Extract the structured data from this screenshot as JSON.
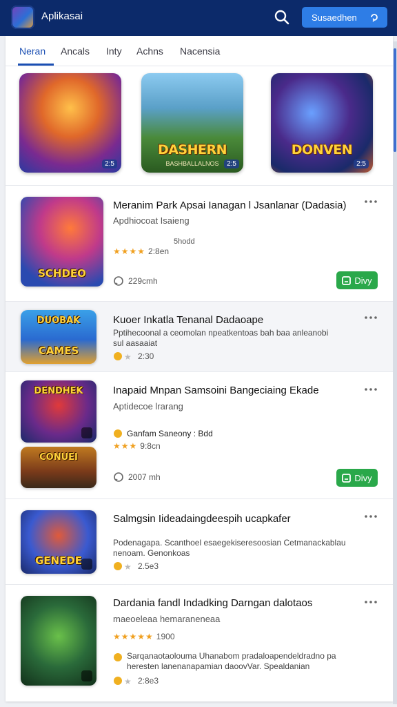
{
  "header": {
    "app_title": "Aplikasai",
    "action_label": "Susaedhen"
  },
  "tabs": [
    {
      "label": "Neran",
      "active": true
    },
    {
      "label": "Ancals",
      "active": false
    },
    {
      "label": "Inty",
      "active": false
    },
    {
      "label": "Achns",
      "active": false
    },
    {
      "label": "Nacensia",
      "active": false
    }
  ],
  "featured": [
    {
      "title": "",
      "sub": "",
      "badge": "2:5",
      "colors": [
        "#f08a24",
        "#7a2a90",
        "#2a3aa0"
      ]
    },
    {
      "title": "DASHERN",
      "sub": "BASHBALLALNOS",
      "badge": "2:5",
      "colors": [
        "#7fc0e8",
        "#4a8a3a",
        "#2a5a20"
      ]
    },
    {
      "title": "DONVEN",
      "sub": "",
      "badge": "2:5",
      "colors": [
        "#1a2a6a",
        "#4a2a8a",
        "#c05a30"
      ]
    }
  ],
  "apps": [
    {
      "title": "Meranim Park Apsai  Ianagan l Jsanlanar (Dadasia)",
      "subtitle": "Apdhiocoat Isaieng",
      "note": "5hodd",
      "stars": "★★★★",
      "rating_count": "2:8en",
      "size": "229cmh",
      "button": "Divy",
      "thumb_text": "SCHDEO"
    },
    {
      "title": "Kuoer Inkatla Tenanal Dadaoape",
      "description": "Pptihecoonal a ceomolan npeatkentoas bah baa anleanobi sul aasaaiat",
      "score_icons": "2:30",
      "thumb_top": "DUOBAK",
      "thumb_text": "CAMES"
    },
    {
      "title": "Inapaid Mnpan Samsoini Bangeciaing Ekade",
      "subtitle": "Aptidecoe lrarang",
      "feature_line": "Ganfam Saneony : Bdd",
      "stars": "★★★",
      "rating_count": "9:8cn",
      "size": "2007 mh",
      "button": "Divy",
      "thumb_top": "DENDHEK",
      "thumb_text": "CONUEI"
    },
    {
      "title": "Salmgsin Iideadaingdeespih ucapkafer",
      "description": "Podenagapa. Scanthoel esaegekiseresoosian Cetmanackablau nenoam. Genonkoas",
      "score_icons": "2.5e3",
      "thumb_text": "GENEDE"
    },
    {
      "title": "Dardania fandl Indadking Darngan dalotaos",
      "subtitle": "maeoeleaa hemaraneneaa",
      "stars": "★★★★★",
      "rating_count": "1900",
      "description": "Sarqanaotaolouma Uhanabom pradaloapendeldradno pa heresten lanenanapamian daoovVar. Spealdanian",
      "score_icons": "2:8e3"
    }
  ],
  "colors": {
    "header": "#0c2a6a",
    "accent": "#2e7de6",
    "green": "#2aa84a",
    "star": "#f0a020"
  },
  "icons": [
    "app-logo-icon",
    "search-icon",
    "chevron-icon",
    "more-icon",
    "comment-icon",
    "download-icon"
  ]
}
